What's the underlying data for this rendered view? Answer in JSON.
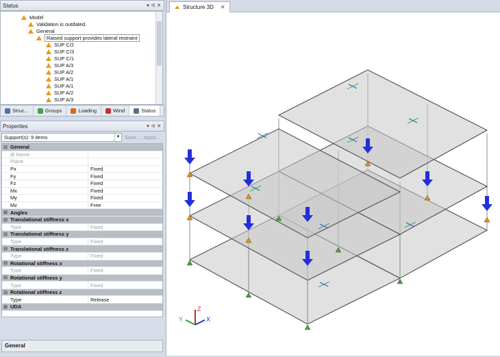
{
  "status_panel": {
    "title": "Status",
    "tree": [
      {
        "label": "Model",
        "level": 1,
        "selected": false
      },
      {
        "label": "Validation is outdated.",
        "level": 2,
        "selected": false
      },
      {
        "label": "General",
        "level": 2,
        "selected": false
      },
      {
        "label": "Raised support provides lateral restraint",
        "level": 3,
        "selected": true
      },
      {
        "label": "SUP C/2",
        "level": 4,
        "selected": false
      },
      {
        "label": "SUP C/3",
        "level": 4,
        "selected": false
      },
      {
        "label": "SUP C/1",
        "level": 4,
        "selected": false
      },
      {
        "label": "SUP A/3",
        "level": 4,
        "selected": false
      },
      {
        "label": "SUP A/2",
        "level": 4,
        "selected": false
      },
      {
        "label": "SUP A/1",
        "level": 4,
        "selected": false
      },
      {
        "label": "SUP A/1",
        "level": 4,
        "selected": false
      },
      {
        "label": "SUP A/2",
        "level": 4,
        "selected": false
      },
      {
        "label": "SUP A/3",
        "level": 4,
        "selected": false
      }
    ],
    "tabs": [
      {
        "label": "Struc...",
        "icon": "structure-icon"
      },
      {
        "label": "Groups",
        "icon": "groups-icon"
      },
      {
        "label": "Loading",
        "icon": "loading-icon"
      },
      {
        "label": "Wind",
        "icon": "wind-icon"
      },
      {
        "label": "Status",
        "icon": "status-icon",
        "active": true
      }
    ]
  },
  "properties_panel": {
    "title": "Properties",
    "selector_value": "Support(s): 9 items",
    "save_label": "Save...",
    "apply_label": "Apply...",
    "rows": [
      {
        "type": "cat",
        "key": "General",
        "exp": "⊟"
      },
      {
        "type": "grey",
        "key": "⊞ Name",
        "value": ""
      },
      {
        "type": "grey",
        "key": "Plane",
        "value": ""
      },
      {
        "type": "row",
        "key": "Px",
        "value": "Fixed"
      },
      {
        "type": "row",
        "key": "Fy",
        "value": "Fixed"
      },
      {
        "type": "row",
        "key": "Fz",
        "value": "Fixed"
      },
      {
        "type": "row",
        "key": "Mx",
        "value": "Fixed"
      },
      {
        "type": "row",
        "key": "My",
        "value": "Fixed"
      },
      {
        "type": "row",
        "key": "Mz",
        "value": "Free"
      },
      {
        "type": "cat",
        "key": "Angles",
        "exp": "⊞"
      },
      {
        "type": "cat",
        "key": "Translational stiffness x",
        "exp": "⊟"
      },
      {
        "type": "grey",
        "key": "Type",
        "value": "Fixed"
      },
      {
        "type": "cat",
        "key": "Translational stiffness y",
        "exp": "⊟"
      },
      {
        "type": "grey",
        "key": "Type",
        "value": "Fixed"
      },
      {
        "type": "cat",
        "key": "Translational stiffness z",
        "exp": "⊟"
      },
      {
        "type": "grey",
        "key": "Type",
        "value": "Fixed"
      },
      {
        "type": "cat",
        "key": "Rotational stiffness x",
        "exp": "⊟"
      },
      {
        "type": "grey",
        "key": "Type",
        "value": "Fixed"
      },
      {
        "type": "cat",
        "key": "Rotational stiffness y",
        "exp": "⊟"
      },
      {
        "type": "grey",
        "key": "Type",
        "value": "Fixed"
      },
      {
        "type": "cat",
        "key": "Rotational stiffness z",
        "exp": "⊟"
      },
      {
        "type": "row",
        "key": "Type",
        "value": "Release"
      },
      {
        "type": "cat",
        "key": "UDA",
        "exp": "⊞"
      }
    ],
    "description_title": "General"
  },
  "viewport": {
    "tab_label": "Structure 3D",
    "axis_labels": {
      "x": "X",
      "y": "Y",
      "z": "Z"
    },
    "colors": {
      "load_arrow": "#2230d8",
      "support_orange": "#e5901a",
      "support_green": "#3fa24a",
      "slab": "#c8c8c8",
      "edge": "#555555"
    }
  }
}
